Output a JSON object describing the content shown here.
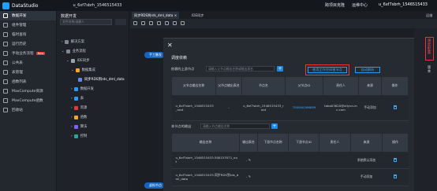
{
  "topbar": {
    "brand": "DataStudio",
    "project": "u_6xf7sbrh_1546515433",
    "links": [
      "跨项目克隆",
      "运维中心",
      "u_6xf7sbrh_1546515433"
    ]
  },
  "leftnav": {
    "items": [
      {
        "label": "数据开发",
        "active": true
      },
      {
        "label": "组件管理"
      },
      {
        "label": "临时查询"
      },
      {
        "label": "运行历史"
      },
      {
        "label": "手动业务流程",
        "badge": "New"
      },
      {
        "label": "公共表"
      },
      {
        "label": "表管理"
      },
      {
        "label": "函数列表"
      },
      {
        "label": "MaxCompute资源"
      },
      {
        "label": "MaxCompute函数"
      },
      {
        "label": "回收站"
      }
    ]
  },
  "tree": {
    "title": "数据开发",
    "search_placeholder": "文件名称/创建人",
    "rows": [
      {
        "label": "解决方案",
        "color": "#7f8794"
      },
      {
        "label": "业务流程",
        "color": "#7f8794"
      },
      {
        "label": "IDE同步",
        "color": "#9aa3b0"
      },
      {
        "label": "数据集成",
        "color": "#f5a623"
      },
      {
        "label": "同步RDS到rds_dml_data",
        "color": "#5b8def"
      },
      {
        "label": "数据开发",
        "color": "#1e9fff"
      },
      {
        "label": "表",
        "color": "#1e9fff"
      },
      {
        "label": "资源",
        "color": "#e53935"
      },
      {
        "label": "函数",
        "color": "#f5a623"
      },
      {
        "label": "算法",
        "color": "#7b61ff"
      },
      {
        "label": "控制",
        "color": "#26a69a"
      }
    ]
  },
  "tabs": [
    {
      "label": "同步RDS到rds_dml_data",
      "active": true
    },
    {
      "label": "IDE同步",
      "active": false
    }
  ],
  "tabs_right_text": "运维",
  "canvas_pills": [
    "手工触发",
    "虚拟节点"
  ],
  "rightbar": {
    "tabs": [
      {
        "label": "调度配置",
        "highlight": true
      },
      {
        "label": "版本",
        "highlight": false
      }
    ]
  },
  "dialog": {
    "close": "✕",
    "section1_title": "调度依赖",
    "upstream_label": "依赖的上游节点",
    "upstream_placeholder": "请输入父节点输出名称或输出表名",
    "btn_use_workspace_root": "使用工作空间根节点",
    "btn_auto_parse": "自动解析",
    "parent_table": {
      "headers": [
        "父节点输出名称",
        "父节点输出表名",
        "节点名",
        "父节点ID",
        "责任人",
        "来源",
        "操作"
      ],
      "rows": [
        {
          "output_name": "u_6xf7sbrh_1546515433_root",
          "output_table": "-",
          "node_name": "u_6xf7sbrh_1546515433_root",
          "node_id": "700000266889",
          "owner": "taba03620@aliyun-inc.com",
          "source": "手动添加"
        }
      ]
    },
    "output_label": "本节点的输出",
    "output_placeholder": "请输入节点输出名称",
    "output_table": {
      "headers": [
        "输出名称",
        "输出表名",
        "下游节点名称",
        "下游节点ID",
        "责任人",
        "来源",
        "操作"
      ],
      "rows": [
        {
          "output_name": "u_6xf7sbrh_1546515433.500153571_out",
          "output_table": "- ✎",
          "source": "系统默认添加"
        },
        {
          "output_name": "u_6xf7sbrh_1546515433.同步RDS到rds_dml_data",
          "output_table": "- ✎",
          "source": "手动添加"
        }
      ]
    }
  }
}
